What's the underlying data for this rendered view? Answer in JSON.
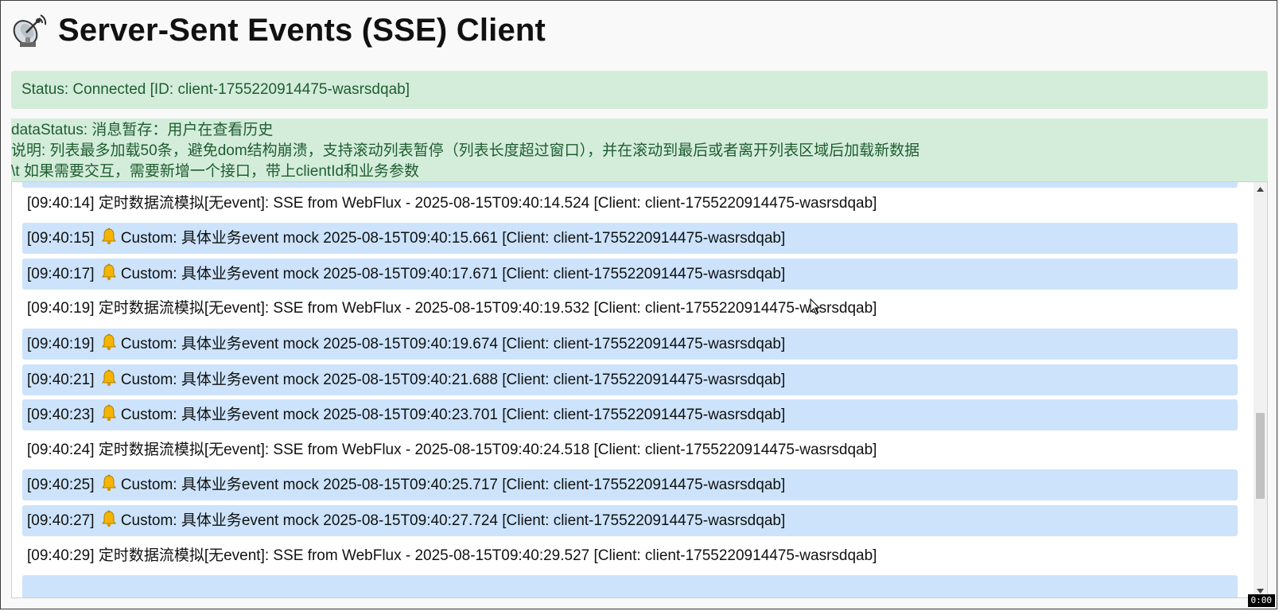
{
  "header": {
    "title": "Server-Sent Events (SSE) Client",
    "icon": "satellite-antenna-icon"
  },
  "status": {
    "text": "Status: Connected [ID: client-1755220914475-wasrsdqab]"
  },
  "data_status": {
    "line1": "dataStatus: 消息暂存：用户在查看历史",
    "line2": "说明: 列表最多加载50条，避免dom结构崩溃，支持滚动列表暂停（列表长度超过窗口），并在滚动到最后或者离开列表区域后加载新数据",
    "line3": "\\t 如果需要交互，需要新增一个接口，带上clientId和业务参数"
  },
  "messages": [
    {
      "type": "timer",
      "time": "[09:40:14]",
      "text": "定时数据流模拟[无event]: SSE from WebFlux - 2025-08-15T09:40:14.524 [Client: client-1755220914475-wasrsdqab]"
    },
    {
      "type": "custom",
      "time": "[09:40:15]",
      "text": "Custom: 具体业务event mock 2025-08-15T09:40:15.661 [Client: client-1755220914475-wasrsdqab]"
    },
    {
      "type": "custom",
      "time": "[09:40:17]",
      "text": "Custom: 具体业务event mock 2025-08-15T09:40:17.671 [Client: client-1755220914475-wasrsdqab]"
    },
    {
      "type": "timer",
      "time": "[09:40:19]",
      "text": "定时数据流模拟[无event]: SSE from WebFlux - 2025-08-15T09:40:19.532 [Client: client-1755220914475-wasrsdqab]"
    },
    {
      "type": "custom",
      "time": "[09:40:19]",
      "text": "Custom: 具体业务event mock 2025-08-15T09:40:19.674 [Client: client-1755220914475-wasrsdqab]"
    },
    {
      "type": "custom",
      "time": "[09:40:21]",
      "text": "Custom: 具体业务event mock 2025-08-15T09:40:21.688 [Client: client-1755220914475-wasrsdqab]"
    },
    {
      "type": "custom",
      "time": "[09:40:23]",
      "text": "Custom: 具体业务event mock 2025-08-15T09:40:23.701 [Client: client-1755220914475-wasrsdqab]"
    },
    {
      "type": "timer",
      "time": "[09:40:24]",
      "text": "定时数据流模拟[无event]: SSE from WebFlux - 2025-08-15T09:40:24.518 [Client: client-1755220914475-wasrsdqab]"
    },
    {
      "type": "custom",
      "time": "[09:40:25]",
      "text": "Custom: 具体业务event mock 2025-08-15T09:40:25.717 [Client: client-1755220914475-wasrsdqab]"
    },
    {
      "type": "custom",
      "time": "[09:40:27]",
      "text": "Custom: 具体业务event mock 2025-08-15T09:40:27.724 [Client: client-1755220914475-wasrsdqab]"
    },
    {
      "type": "timer",
      "time": "[09:40:29]",
      "text": "定时数据流模拟[无event]: SSE from WebFlux - 2025-08-15T09:40:29.527 [Client: client-1755220914475-wasrsdqab]"
    }
  ],
  "recording_timer": "0:00",
  "colors": {
    "status_bg": "#d4eddb",
    "status_text": "#1f5d30",
    "custom_row_bg": "#cce3fb"
  }
}
